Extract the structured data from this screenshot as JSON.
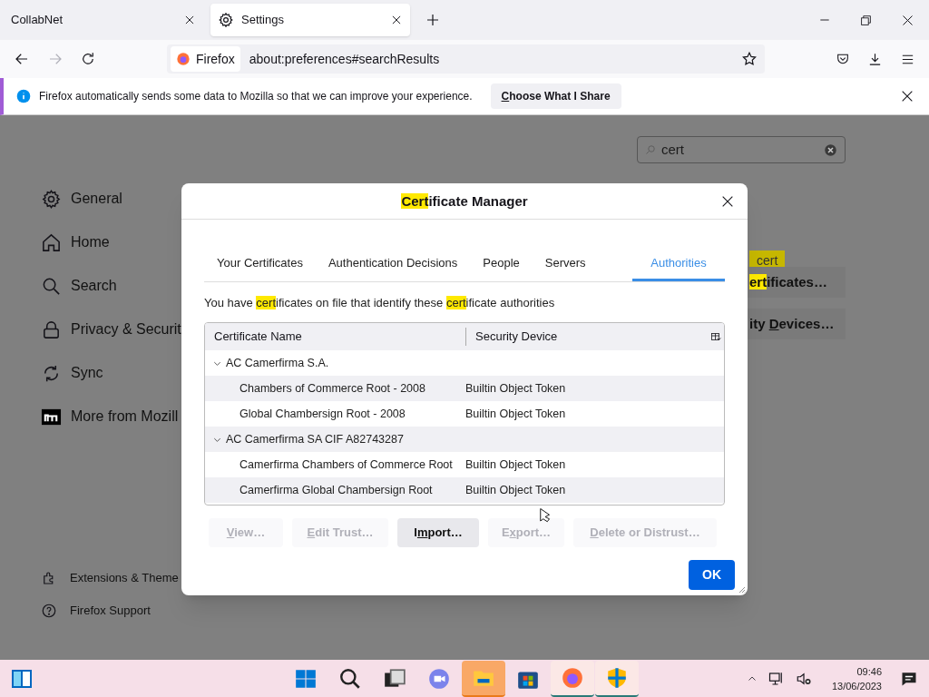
{
  "browser_tabs": [
    {
      "title": "CollabNet",
      "selected": false
    },
    {
      "title": "Settings",
      "selected": true
    }
  ],
  "address_bar": {
    "identity": "Firefox",
    "url": "about:preferences#searchResults"
  },
  "notification": {
    "message": "Firefox automatically sends some data to Mozilla so that we can improve your experience.",
    "button": [
      {
        "text": "C",
        "kind": "underline"
      },
      {
        "text": "hoose What I Share",
        "kind": "plain"
      }
    ]
  },
  "search": {
    "value": "cert"
  },
  "sidebar": {
    "items": [
      "General",
      "Home",
      "Search",
      "Privacy & Securit",
      "Sync",
      "More from Mozill"
    ],
    "footer": [
      "Extensions & Theme",
      "Firefox Support"
    ]
  },
  "search_tag": "cert",
  "background_buttons": [
    [
      {
        "text": "ert",
        "kind": "highlight"
      },
      {
        "text": "ificates…",
        "kind": "plain"
      }
    ],
    [
      {
        "text": "ity ",
        "kind": "plain"
      },
      {
        "text": "D",
        "kind": "underline"
      },
      {
        "text": "evices…",
        "kind": "plain"
      }
    ]
  ],
  "dialog": {
    "title": [
      {
        "text": "Cert",
        "kind": "highlight"
      },
      {
        "text": "ificate Manager",
        "kind": "plain"
      }
    ],
    "tabs": [
      {
        "label": "Your Certificates",
        "selected": false
      },
      {
        "label": "Authentication Decisions",
        "selected": false
      },
      {
        "label": "People",
        "selected": false
      },
      {
        "label": "Servers",
        "selected": false
      },
      {
        "label": "Authorities",
        "selected": true
      }
    ],
    "description": [
      {
        "text": "You have ",
        "kind": "plain"
      },
      {
        "text": "cert",
        "kind": "highlight"
      },
      {
        "text": "ificates on file that identify these ",
        "kind": "plain"
      },
      {
        "text": "cert",
        "kind": "highlight"
      },
      {
        "text": "ificate authorities",
        "kind": "plain"
      }
    ],
    "columns": [
      "Certificate Name",
      "Security Device"
    ],
    "groups": [
      {
        "name": "AC Camerfirma S.A.",
        "expanded": true,
        "children": [
          {
            "name": "Chambers of Commerce Root - 2008",
            "device": "Builtin Object Token"
          },
          {
            "name": "Global Chambersign Root - 2008",
            "device": "Builtin Object Token"
          }
        ]
      },
      {
        "name": "AC Camerfirma SA CIF A82743287",
        "expanded": true,
        "children": [
          {
            "name": "Camerfirma Chambers of Commerce Root",
            "device": "Builtin Object Token"
          },
          {
            "name": "Camerfirma Global Chambersign Root",
            "device": "Builtin Object Token"
          }
        ]
      }
    ],
    "buttons": [
      {
        "disabled": true,
        "label": [
          {
            "text": "V",
            "kind": "underline"
          },
          {
            "text": "iew…",
            "kind": "plain"
          }
        ]
      },
      {
        "disabled": true,
        "label": [
          {
            "text": "E",
            "kind": "underline"
          },
          {
            "text": "dit Trust…",
            "kind": "plain"
          }
        ]
      },
      {
        "disabled": false,
        "label": [
          {
            "text": "I",
            "kind": "plain"
          },
          {
            "text": "m",
            "kind": "underline"
          },
          {
            "text": "port…",
            "kind": "plain"
          }
        ]
      },
      {
        "disabled": true,
        "label": [
          {
            "text": "E",
            "kind": "plain"
          },
          {
            "text": "x",
            "kind": "underline"
          },
          {
            "text": "port…",
            "kind": "plain"
          }
        ]
      },
      {
        "disabled": true,
        "label": [
          {
            "text": "D",
            "kind": "underline"
          },
          {
            "text": "elete or Distrust…",
            "kind": "plain"
          }
        ]
      }
    ],
    "ok": "OK"
  },
  "taskbar": {
    "apps": [
      {
        "open": false
      },
      {
        "open": false
      },
      {
        "open": false
      },
      {
        "open": false
      },
      {
        "open": true
      },
      {
        "open": false
      },
      {
        "open": true
      },
      {
        "open": true
      }
    ],
    "time": "09:46",
    "date": "13/06/2023"
  }
}
